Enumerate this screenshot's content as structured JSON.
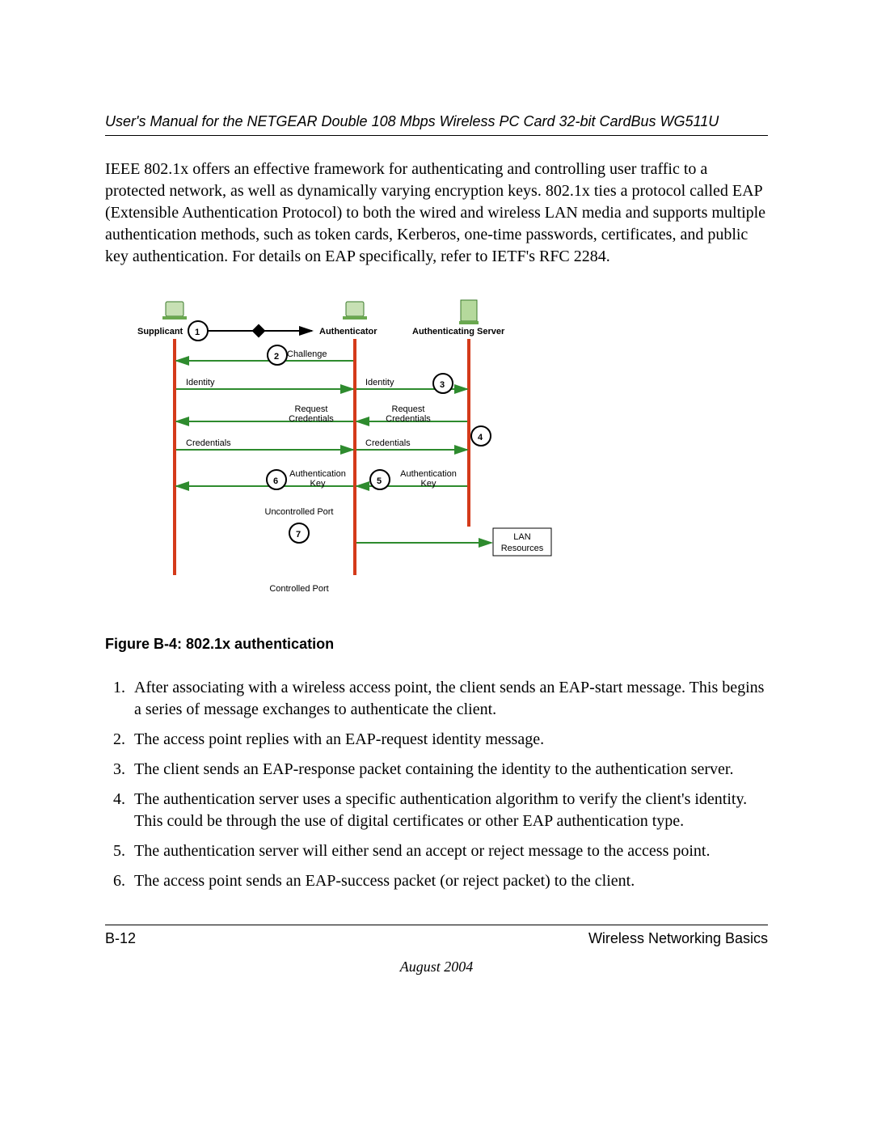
{
  "header": {
    "title": "User's Manual for the NETGEAR Double 108 Mbps Wireless PC Card 32-bit CardBus WG511U"
  },
  "paragraph": "IEEE 802.1x offers an effective framework for authenticating and controlling user traffic to a protected network, as well as dynamically varying encryption keys. 802.1x ties a protocol called EAP (Extensible Authentication Protocol) to both the wired and wireless LAN media and supports multiple authentication methods, such as token cards, Kerberos, one-time passwords, certificates, and public key authentication. For details on EAP specifically, refer to IETF's RFC 2284.",
  "figure": {
    "caption": "Figure B-4:  802.1x authentication",
    "labels": {
      "supplicant": "Supplicant",
      "authenticator": "Authenticator",
      "auth_server": "Authenticating Server",
      "challenge": "Challenge",
      "identity1": "Identity",
      "identity2": "Identity",
      "request_cred1_l1": "Request",
      "request_cred1_l2": "Credentials",
      "request_cred2_l1": "Request",
      "request_cred2_l2": "Credentials",
      "credentials1": "Credentials",
      "credentials2": "Credentials",
      "auth_key1_l1": "Authentication",
      "auth_key1_l2": "Key",
      "auth_key2_l1": "Authentication",
      "auth_key2_l2": "Key",
      "uncontrolled": "Uncontrolled Port",
      "controlled": "Controlled Port",
      "lan_l1": "LAN",
      "lan_l2": "Resources",
      "n1": "1",
      "n2": "2",
      "n3": "3",
      "n4": "4",
      "n5": "5",
      "n6": "6",
      "n7": "7"
    }
  },
  "steps": [
    "After associating with a wireless access point, the client sends an EAP-start message. This begins a series of message exchanges to authenticate the client.",
    "The access point replies with an EAP-request identity message.",
    "The client sends an EAP-response packet containing the identity to the authentication server.",
    "The authentication server uses a specific authentication algorithm to verify the client's identity. This could be through the use of digital certificates or other EAP authentication type.",
    "The authentication server will either send an accept or reject message to the access point.",
    "The access point sends an EAP-success packet (or reject packet) to the client."
  ],
  "footer": {
    "page_num": "B-12",
    "section": "Wireless Networking Basics",
    "date": "August 2004"
  }
}
